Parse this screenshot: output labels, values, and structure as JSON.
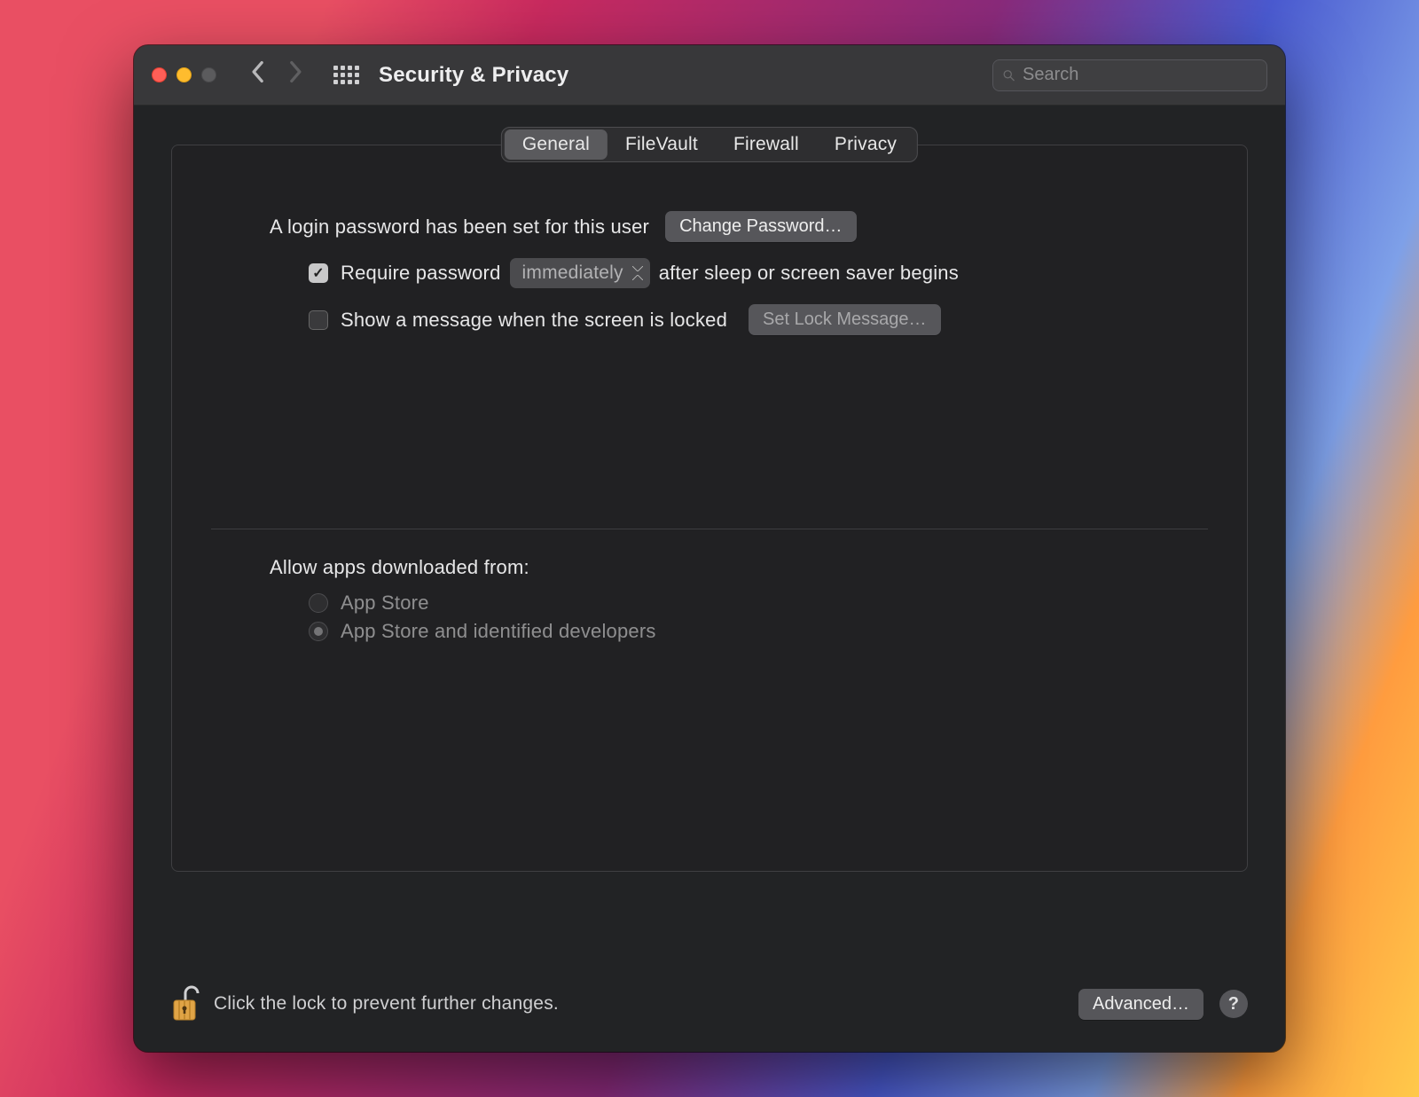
{
  "window": {
    "title": "Security & Privacy"
  },
  "search": {
    "placeholder": "Search",
    "value": ""
  },
  "tabs": [
    {
      "label": "General",
      "active": true
    },
    {
      "label": "FileVault",
      "active": false
    },
    {
      "label": "Firewall",
      "active": false
    },
    {
      "label": "Privacy",
      "active": false
    }
  ],
  "general": {
    "login_password_text": "A login password has been set for this user",
    "change_password_button": "Change Password…",
    "require_password": {
      "checked": true,
      "label_before": "Require password",
      "select_value": "immediately",
      "label_after": "after sleep or screen saver begins"
    },
    "lock_message": {
      "checked": false,
      "label": "Show a message when the screen is locked",
      "button": "Set Lock Message…"
    },
    "allow_apps_heading": "Allow apps downloaded from:",
    "allow_apps_options": [
      {
        "label": "App Store",
        "checked": false
      },
      {
        "label": "App Store and identified developers",
        "checked": true
      }
    ]
  },
  "footer": {
    "lock_text": "Click the lock to prevent further changes.",
    "advanced_button": "Advanced…",
    "help_label": "?"
  }
}
